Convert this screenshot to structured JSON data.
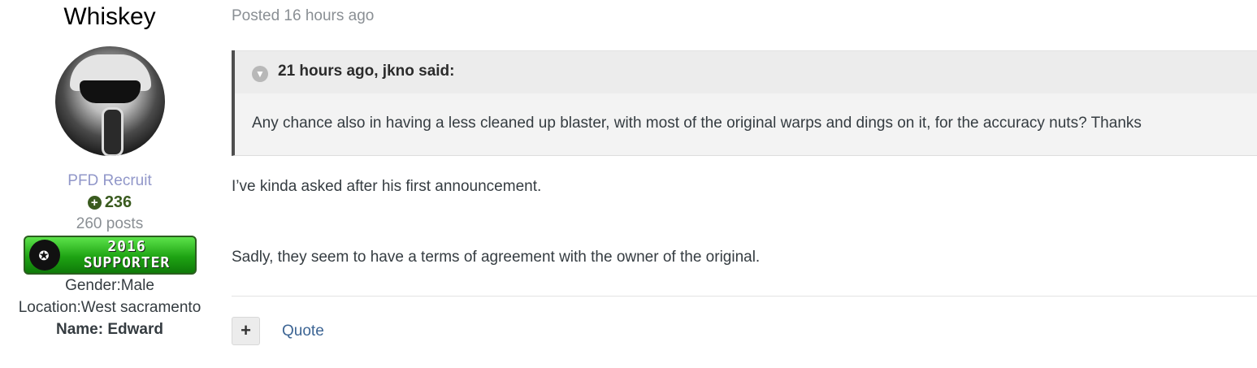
{
  "author": {
    "name": "Whiskey",
    "group": "PFD Recruit",
    "reputation": "236",
    "posts": "260 posts",
    "badge": {
      "line1": "2016",
      "line2": "SUPPORTER"
    },
    "fields": [
      "Gender:Male",
      "Location:West sacramento",
      "Name: Edward"
    ]
  },
  "post": {
    "posted": "Posted 16 hours ago",
    "quote": {
      "header": "21 hours ago, jkno said:",
      "text": "Any chance also in having a less cleaned up blaster, with most of the original warps and dings on it, for the accuracy nuts? Thanks"
    },
    "paragraphs": [
      "I’ve kinda asked after his first announcement.",
      "Sadly, they seem to have a terms of agreement with the owner of the original."
    ],
    "actions": {
      "multiquote": "+",
      "quote": "Quote"
    }
  },
  "icons": {
    "reputation": "plus-circle-icon",
    "toggle": "chevron-down-icon"
  },
  "colors": {
    "group": "#9197c9",
    "reputation": "#3a5b1f",
    "link": "#3d6594",
    "quote_border": "#4e4e4e"
  }
}
